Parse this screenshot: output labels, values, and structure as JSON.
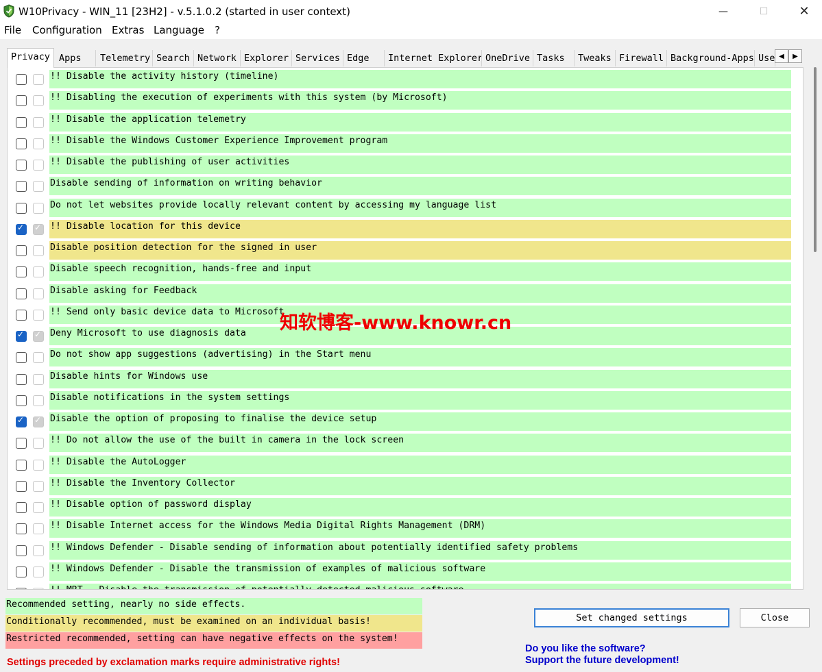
{
  "window": {
    "title": "W10Privacy - WIN_11 [23H2]  - v.5.1.0.2 (started in user context)",
    "minimize_glyph": "—",
    "maximize_glyph": "☐",
    "close_glyph": "✕"
  },
  "menu": [
    "File",
    "Configuration",
    "Extras",
    "Language",
    "?"
  ],
  "tabs": [
    "Privacy",
    "Apps",
    "Telemetry",
    "Search",
    "Network",
    "Explorer",
    "Services",
    "Edge",
    "Internet Explorer",
    "OneDrive",
    "Tasks",
    "Tweaks",
    "Firewall",
    "Background-Apps",
    "User"
  ],
  "active_tab": "Privacy",
  "tab_scroll": {
    "left_glyph": "◀",
    "right_glyph": "▶"
  },
  "settings": [
    {
      "label": "!! Disable the activity history (timeline)",
      "level": "green",
      "checked": false
    },
    {
      "label": "!! Disabling the execution of experiments with this system (by Microsoft)",
      "level": "green",
      "checked": false
    },
    {
      "label": "!! Disable the application telemetry",
      "level": "green",
      "checked": false
    },
    {
      "label": "!! Disable the Windows Customer Experience Improvement program",
      "level": "green",
      "checked": false
    },
    {
      "label": "!! Disable the publishing of user activities",
      "level": "green",
      "checked": false
    },
    {
      "label": "Disable sending of information on writing behavior",
      "level": "green",
      "checked": false
    },
    {
      "label": "Do not let websites provide locally relevant content by accessing my language list",
      "level": "green",
      "checked": false
    },
    {
      "label": "!! Disable location for this device",
      "level": "yellow",
      "checked": true
    },
    {
      "label": "Disable position detection for the signed in user",
      "level": "yellow",
      "checked": false
    },
    {
      "label": "Disable speech recognition, hands-free and input",
      "level": "green",
      "checked": false
    },
    {
      "label": "Disable asking for Feedback",
      "level": "green",
      "checked": false
    },
    {
      "label": "!! Send only basic device data to Microsoft",
      "level": "green",
      "checked": false
    },
    {
      "label": "Deny Microsoft to use diagnosis data",
      "level": "green",
      "checked": true
    },
    {
      "label": "Do not show app suggestions (advertising) in the Start menu",
      "level": "green",
      "checked": false
    },
    {
      "label": "Disable hints for Windows use",
      "level": "green",
      "checked": false
    },
    {
      "label": "Disable notifications in the system settings",
      "level": "green",
      "checked": false
    },
    {
      "label": "Disable the option of proposing to finalise the device setup",
      "level": "green",
      "checked": true
    },
    {
      "label": "!! Do not allow the use of the built in camera in the lock screen",
      "level": "green",
      "checked": false
    },
    {
      "label": "!! Disable the AutoLogger",
      "level": "green",
      "checked": false
    },
    {
      "label": "!! Disable the Inventory Collector",
      "level": "green",
      "checked": false
    },
    {
      "label": "!! Disable option of password display",
      "level": "green",
      "checked": false
    },
    {
      "label": "!! Disable Internet access for the Windows Media Digital Rights Management (DRM)",
      "level": "green",
      "checked": false
    },
    {
      "label": "!! Windows Defender - Disable sending of information about potentially identified safety problems",
      "level": "green",
      "checked": false
    },
    {
      "label": "!! Windows Defender - Disable the transmission of examples of malicious software",
      "level": "green",
      "checked": false
    },
    {
      "label": "!! MRT - Disable the transmission of potentially detected malicious software",
      "level": "green",
      "checked": false
    }
  ],
  "legend": {
    "green": "Recommended setting, nearly no side effects.",
    "yellow": "Conditionally recommended, must be examined on an individual basis!",
    "red": "Restricted recommended, setting can have negative effects on the system!"
  },
  "colors": {
    "green": "#c0ffc0",
    "yellow": "#f0e68c",
    "red": "#ffa0a0",
    "checkbox_checked": "#1a63c5"
  },
  "admin_note": "Settings preceded by exclamation marks require administrative rights!",
  "buttons": {
    "set_changed": "Set changed settings",
    "close": "Close"
  },
  "support": {
    "line1": "Do you like the software?",
    "line2": "Support the future development!"
  },
  "watermark": "知软博客-www.knowr.cn"
}
